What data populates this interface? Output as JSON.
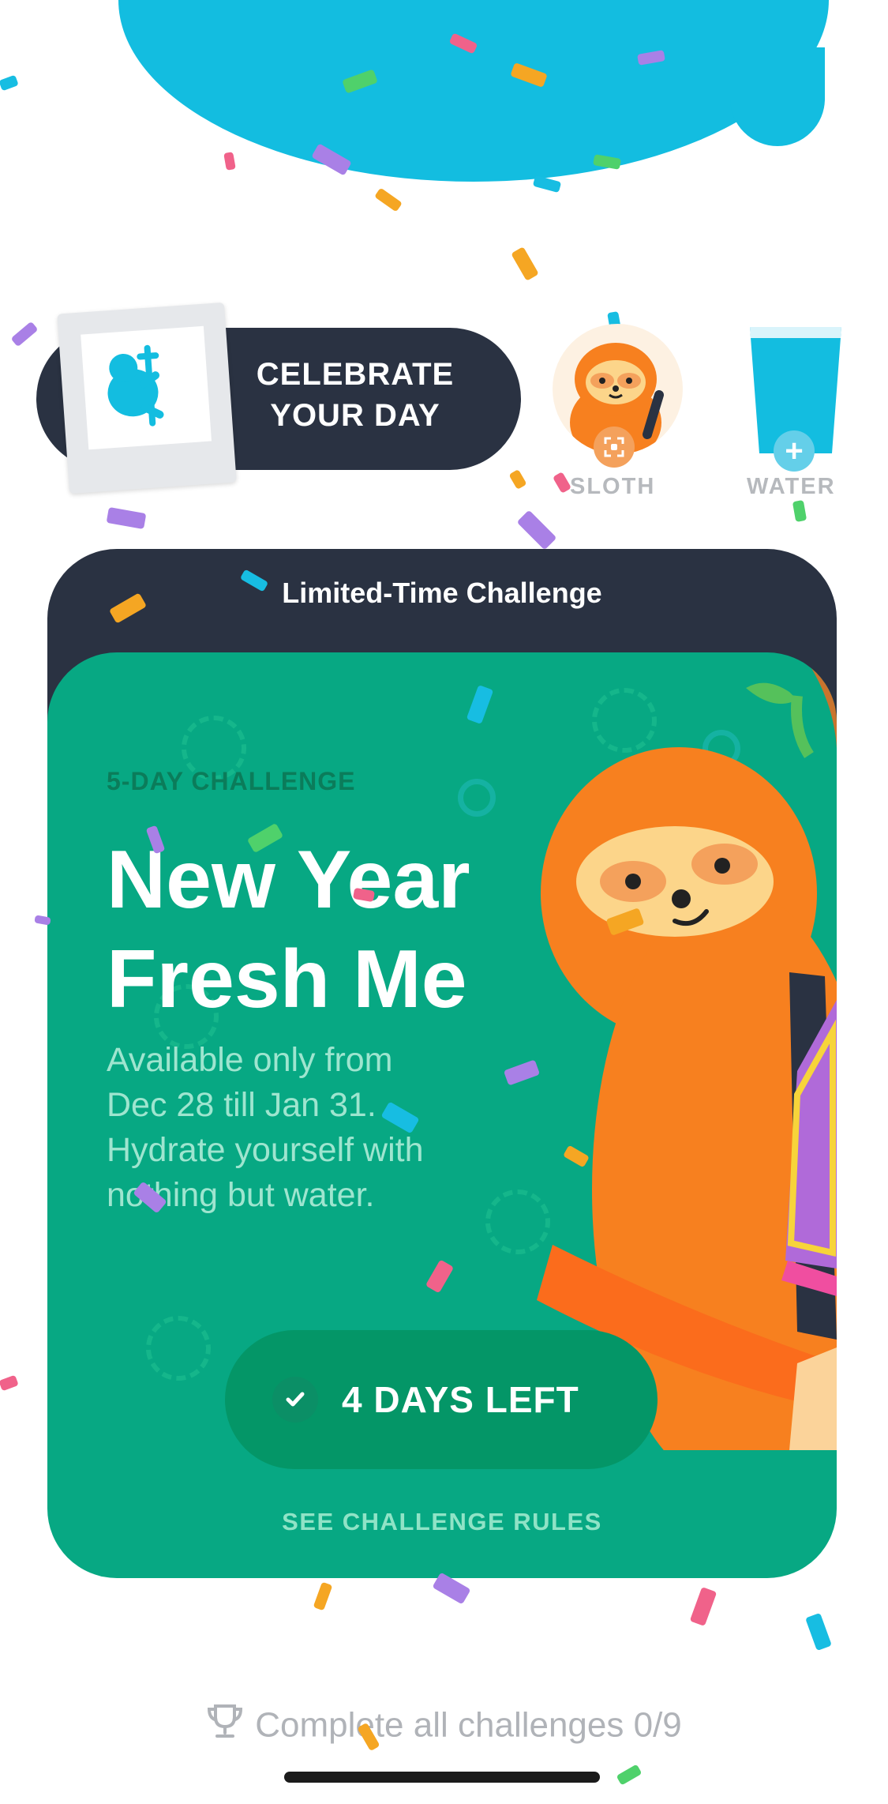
{
  "celebrate": {
    "label_line1": "CELEBRATE",
    "label_line2": "YOUR DAY"
  },
  "shortcuts": [
    {
      "label": "SLOTH",
      "icon": "sloth-avatar-icon"
    },
    {
      "label": "WATER",
      "icon": "water-glass-icon",
      "badge": "+"
    }
  ],
  "challenge": {
    "header_title": "Limited-Time Challenge",
    "eyebrow": "5-DAY CHALLENGE",
    "title_line1": "New Year",
    "title_line2": "Fresh Me",
    "description": "Available only from Dec 28 till Jan 31. Hydrate yourself with nothing but water.",
    "status": "4 DAYS LEFT",
    "rules_link": "SEE CHALLENGE RULES"
  },
  "footer": {
    "text": "Complete all challenges 0/9",
    "icon": "trophy-icon"
  },
  "colors": {
    "accent_cyan": "#13bde0",
    "card_green": "#07a883",
    "dark_navy": "#2a3242",
    "sloth_orange": "#f7801f"
  }
}
